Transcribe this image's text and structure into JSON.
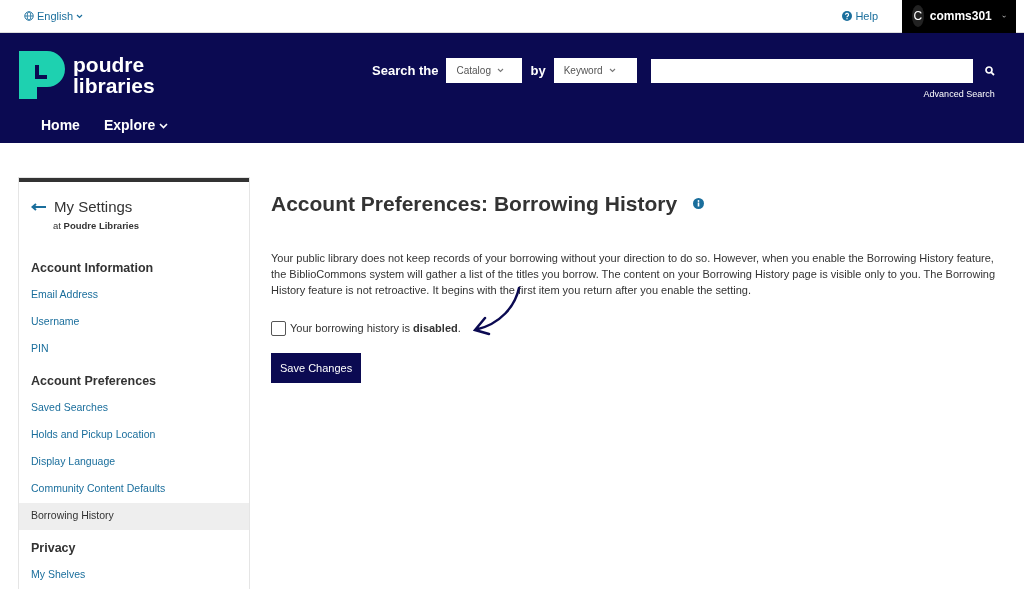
{
  "top_bar": {
    "language": "English",
    "help": "Help",
    "user_initial": "C",
    "username": "comms301"
  },
  "header": {
    "logo_line_1": "poudre",
    "logo_line_2": "libraries",
    "search_label": "Search the",
    "scope": "Catalog",
    "by_label": "by",
    "field": "Keyword",
    "advanced_search": "Advanced Search"
  },
  "nav": [
    {
      "label": "Home",
      "dropdown": false
    },
    {
      "label": "Explore",
      "dropdown": true
    }
  ],
  "sidebar": {
    "title": "My Settings",
    "subtitle_prefix": "at",
    "subtitle_library": "Poudre Libraries",
    "items": [
      {
        "kind": "heading",
        "label": "Account Information"
      },
      {
        "kind": "link",
        "label": "Email Address",
        "selected": false
      },
      {
        "kind": "link",
        "label": "Username",
        "selected": false
      },
      {
        "kind": "link",
        "label": "PIN",
        "selected": false
      },
      {
        "kind": "heading",
        "label": "Account Preferences"
      },
      {
        "kind": "link",
        "label": "Saved Searches",
        "selected": false
      },
      {
        "kind": "link",
        "label": "Holds and Pickup Location",
        "selected": false
      },
      {
        "kind": "link",
        "label": "Display Language",
        "selected": false
      },
      {
        "kind": "link",
        "label": "Community Content Defaults",
        "selected": false
      },
      {
        "kind": "link",
        "label": "Borrowing History",
        "selected": true
      },
      {
        "kind": "heading",
        "label": "Privacy"
      },
      {
        "kind": "link",
        "label": "My Shelves",
        "selected": false
      }
    ]
  },
  "main": {
    "title": "Account Preferences: Borrowing History",
    "description": "Your public library does not keep records of your borrowing without your direction to do so. However, when you enable the Borrowing History feature, the BiblioCommons system will gather a list of the titles you borrow. The content on your Borrowing History page is visible only to you. The Borrowing History feature is not retroactive. It begins with the first item you return after you enable the setting.",
    "checkbox": {
      "label": "Your borrowing history is **disabled**.",
      "checked": false
    },
    "save_button": "Save Changes"
  }
}
